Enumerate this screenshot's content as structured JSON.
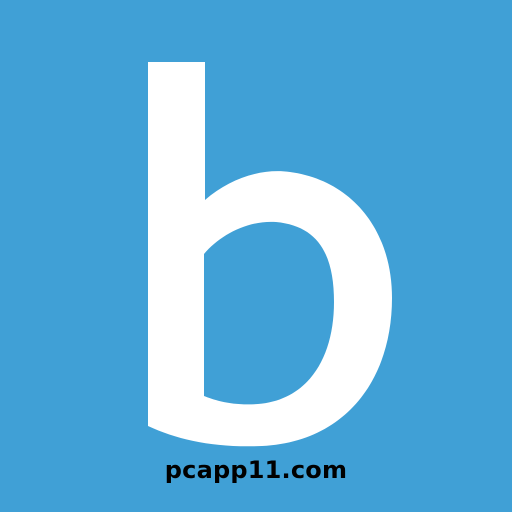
{
  "app_icon": {
    "letter": "b",
    "background_color": "#40a0d6",
    "glyph_color": "#ffffff",
    "icon_name": "letter-b-logo-icon"
  },
  "watermark": {
    "text": "pcapp11.com",
    "color": "#000000"
  }
}
